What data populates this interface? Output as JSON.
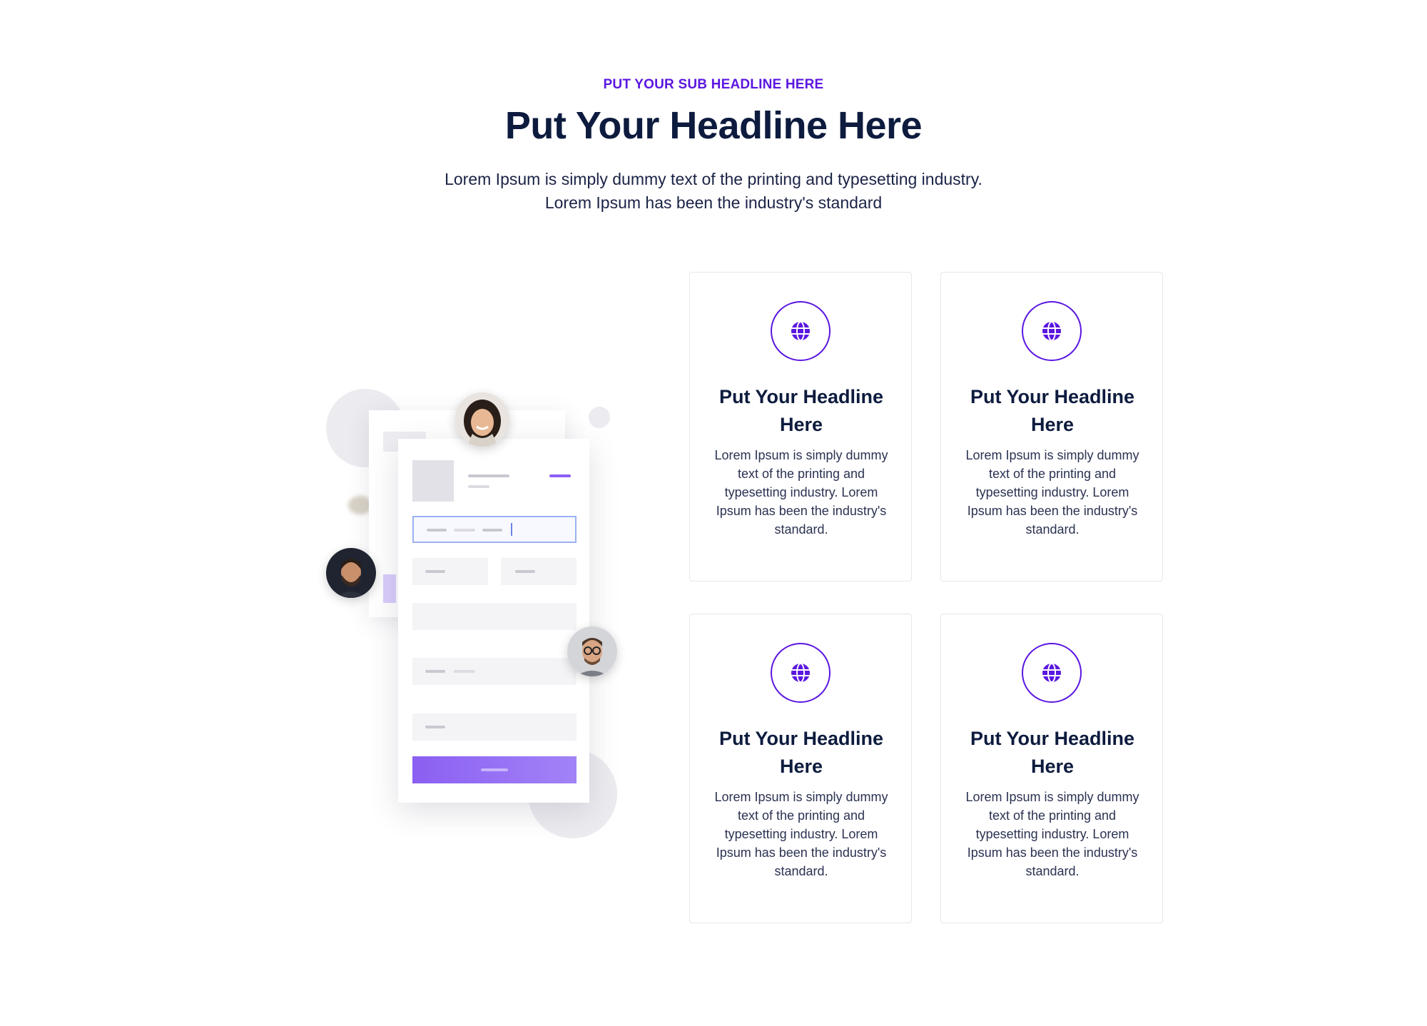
{
  "header": {
    "sub_headline": "PUT YOUR SUB HEADLINE HERE",
    "headline": "Put Your Headline Here",
    "intro": "Lorem Ipsum is simply dummy text of the printing and typesetting industry. Lorem Ipsum has been the industry's standard"
  },
  "features": [
    {
      "icon": "globe-icon",
      "title": "Put Your Headline Here",
      "text": "Lorem Ipsum is simply dummy text of the printing and typesetting industry. Lorem Ipsum has been the industry's standard."
    },
    {
      "icon": "globe-icon",
      "title": "Put Your Headline Here",
      "text": "Lorem Ipsum is simply dummy text of the printing and typesetting industry. Lorem Ipsum has been the industry's standard."
    },
    {
      "icon": "globe-icon",
      "title": "Put Your Headline Here",
      "text": "Lorem Ipsum is simply dummy text of the printing and typesetting industry. Lorem Ipsum has been the industry's standard."
    },
    {
      "icon": "globe-icon",
      "title": "Put Your Headline Here",
      "text": "Lorem Ipsum is simply dummy text of the printing and typesetting industry. Lorem Ipsum has been the industry's standard."
    }
  ],
  "colors": {
    "accent": "#5b17e0",
    "heading": "#0d1b3e",
    "button": "#8b5ff2"
  }
}
